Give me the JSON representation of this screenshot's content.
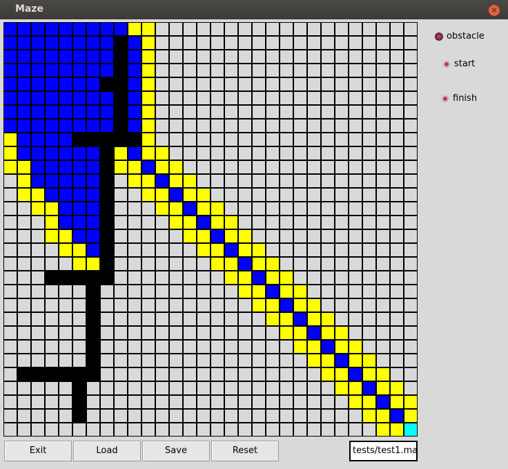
{
  "window": {
    "title": "Maze",
    "close_glyph": "✕"
  },
  "legend": {
    "obstacle": "obstacle",
    "start": "start",
    "finish": "finish",
    "selected": "obstacle"
  },
  "buttons": {
    "exit": "Exit",
    "load": "Load",
    "save": "Save",
    "reset": "Reset"
  },
  "file_field": {
    "value": "tests/test1.map"
  },
  "grid": {
    "size": 30,
    "colors": {
      "empty": "#d9d9d9",
      "obstacle": "#000000",
      "visited": "#ffff00",
      "path": "#0000ff",
      "finish": "#00ffff"
    },
    "legend_codes": ". empty, O obstacle, Y visited, B path, C finish",
    "rows": [
      "BBBBBBBBBYY...................",
      "BBBBBBBBOBY...................",
      "BBBBBBBBOBY...................",
      "BBBBBBBBOBY...................",
      "BBBBBBBOOBY...................",
      "BBBBBBBBOBY...................",
      "BBBBBBBBOBY...................",
      "BBBBBBBBOBY...................",
      "YBBBBOOOOOY...................",
      "YBBBBBBOYBYY..................",
      "YYBBBBBOYYBYY.................",
      ".YBBBBBO.YYBYY................",
      ".YYBBBBO..YYBYY...............",
      "..YYBBBO...YYBYY..............",
      "...YBBBO....YYBYY.............",
      "...YYBBO.....YYBYY............",
      "....YYBO......YYBYY...........",
      ".....YYO.......YYBYY..........",
      "...OOOOO........YYBYY.........",
      "......O..........YYBYY........",
      "......O...........YYBYY.......",
      "......O............YYBYY......",
      "......O.............YYBYY.....",
      "......O..............YYBYY....",
      "......O...............YYBYY...",
      ".OOOOOO................YYBYY..",
      ".....O..................YYBYY.",
      ".....O...................YYBYY",
      ".....O....................YYBY",
      "...........................YYC"
    ]
  }
}
